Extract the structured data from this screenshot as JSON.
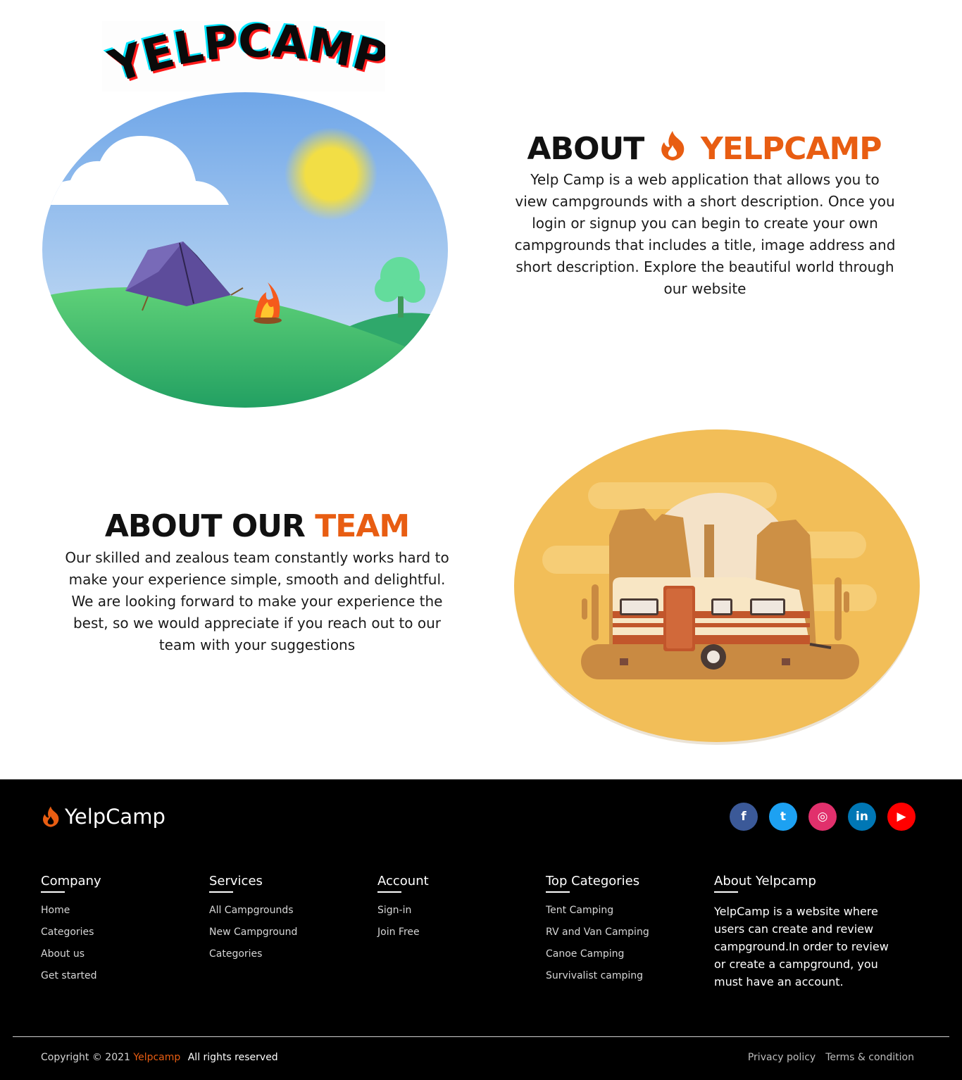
{
  "header": {
    "logo_text": "YELPCAMP"
  },
  "about_section": {
    "title_prefix": "ABOUT",
    "title_accent": "YELPCAMP",
    "description": "Yelp Camp is a web application that allows you to view campgrounds with a short description. Once you login or signup you can begin to create your own campgrounds that includes a title, image address and short description. Explore the beautiful world through our website"
  },
  "team_section": {
    "title_prefix": "ABOUT OUR",
    "title_accent": "TEAM",
    "description": "Our skilled and zealous team constantly works hard to make your experience simple, smooth and delightful. We are looking forward to make your experience the best, so we would appreciate if you reach out to our team with your suggestions"
  },
  "footer": {
    "brand": "YelpCamp",
    "socials": [
      {
        "name": "facebook",
        "glyph": "f",
        "color": "#3b5998"
      },
      {
        "name": "twitter",
        "glyph": "t",
        "color": "#1da1f2"
      },
      {
        "name": "instagram",
        "glyph": "◎",
        "color": "#e1306c"
      },
      {
        "name": "linkedin",
        "glyph": "in",
        "color": "#0077b5"
      },
      {
        "name": "youtube",
        "glyph": "▶",
        "color": "#ff0000"
      }
    ],
    "columns": [
      {
        "title": "Company",
        "links": [
          "Home",
          "Categories",
          "About us",
          "Get started"
        ]
      },
      {
        "title": "Services",
        "links": [
          "All Campgrounds",
          "New Campground",
          "Categories"
        ]
      },
      {
        "title": "Account",
        "links": [
          "Sign-in",
          "Join Free"
        ]
      },
      {
        "title": "Top Categories",
        "links": [
          "Tent Camping",
          "RV and Van Camping",
          "Canoe Camping",
          "Survivalist camping"
        ]
      }
    ],
    "about": {
      "title": "About Yelpcamp",
      "text": "YelpCamp is a website where users can create and review campground.In order to review or create a campground, you must have an account."
    },
    "copyright_prefix": "Copyright © 2021",
    "copyright_brand": "Yelpcamp",
    "copyright_suffix": "All rights reserved",
    "legal_links": [
      "Privacy policy",
      "Terms & condition"
    ]
  },
  "colors": {
    "accent": "#e85d12",
    "footer_bg": "#000000"
  }
}
